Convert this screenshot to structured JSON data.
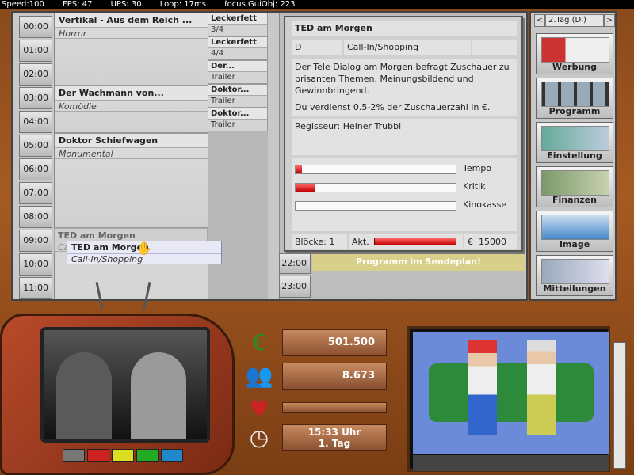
{
  "debug": {
    "speed": "Speed:100",
    "fps": "FPS: 47",
    "ups": "UPS: 30",
    "loop": "Loop: 17ms",
    "focus": "focus GuiObj: 223"
  },
  "hours": [
    "00:00",
    "01:00",
    "02:00",
    "03:00",
    "04:00",
    "05:00",
    "06:00",
    "07:00",
    "08:00",
    "09:00",
    "10:00",
    "11:00"
  ],
  "hours_right": [
    "22:00",
    "23:00"
  ],
  "movies": [
    {
      "title": "Vertikal - Aus dem Reich ...",
      "genre": "Horror"
    },
    {
      "title": "Der Wachmann von...",
      "genre": "Komödie"
    },
    {
      "title": "Doktor Schiefwagen",
      "genre": "Monumental"
    }
  ],
  "ghost": {
    "title": "TED am Morgen",
    "genre": "Ca"
  },
  "drag": {
    "title": "TED am Morgen",
    "genre": "Call-In/Shopping"
  },
  "ads": [
    {
      "title": "Leckerfett",
      "sub": "3/4"
    },
    {
      "title": "Leckerfett",
      "sub": "4/4"
    },
    {
      "title": "Der...",
      "sub": "Trailer"
    },
    {
      "title": "Doktor...",
      "sub": "Trailer"
    },
    {
      "title": "Doktor...",
      "sub": "Trailer"
    }
  ],
  "info_bar": "Programm im Sendeplan!",
  "card": {
    "title": "TED am Morgen",
    "rating": "D",
    "genre": "Call-In/Shopping",
    "description1": "Der Tele Dialog am Morgen befragt Zuschauer zu brisanten Themen. Meinungsbildend und Gewinnbringend.",
    "description2": "Du verdienst 0.5-2% der Zuschauerzahl in €.",
    "director": "Regisseur:  Heiner Trubbl",
    "bars": [
      {
        "label": "Tempo",
        "value": 0.04
      },
      {
        "label": "Kritik",
        "value": 0.12
      },
      {
        "label": "Kinokasse",
        "value": 0.0
      }
    ],
    "blocks": "Blöcke: 1",
    "akt": "Akt.",
    "price_symbol": "€",
    "price": "15000"
  },
  "sidebar": {
    "day": "2.Tag (Di)",
    "prev": "<",
    "next": ">",
    "buttons": [
      {
        "label": "Werbung",
        "icon": "spot-icon"
      },
      {
        "label": "Programm",
        "icon": "film-icon"
      },
      {
        "label": "Einstellung",
        "icon": "settings-icon"
      },
      {
        "label": "Finanzen",
        "icon": "money-icon"
      },
      {
        "label": "Image",
        "icon": "image-chart-icon"
      },
      {
        "label": "Mitteilungen",
        "icon": "newspaper-icon"
      }
    ]
  },
  "stats": {
    "money": "501.500",
    "audience": "8.673",
    "image": "",
    "time": "15:33 Uhr",
    "day": "1. Tag"
  }
}
